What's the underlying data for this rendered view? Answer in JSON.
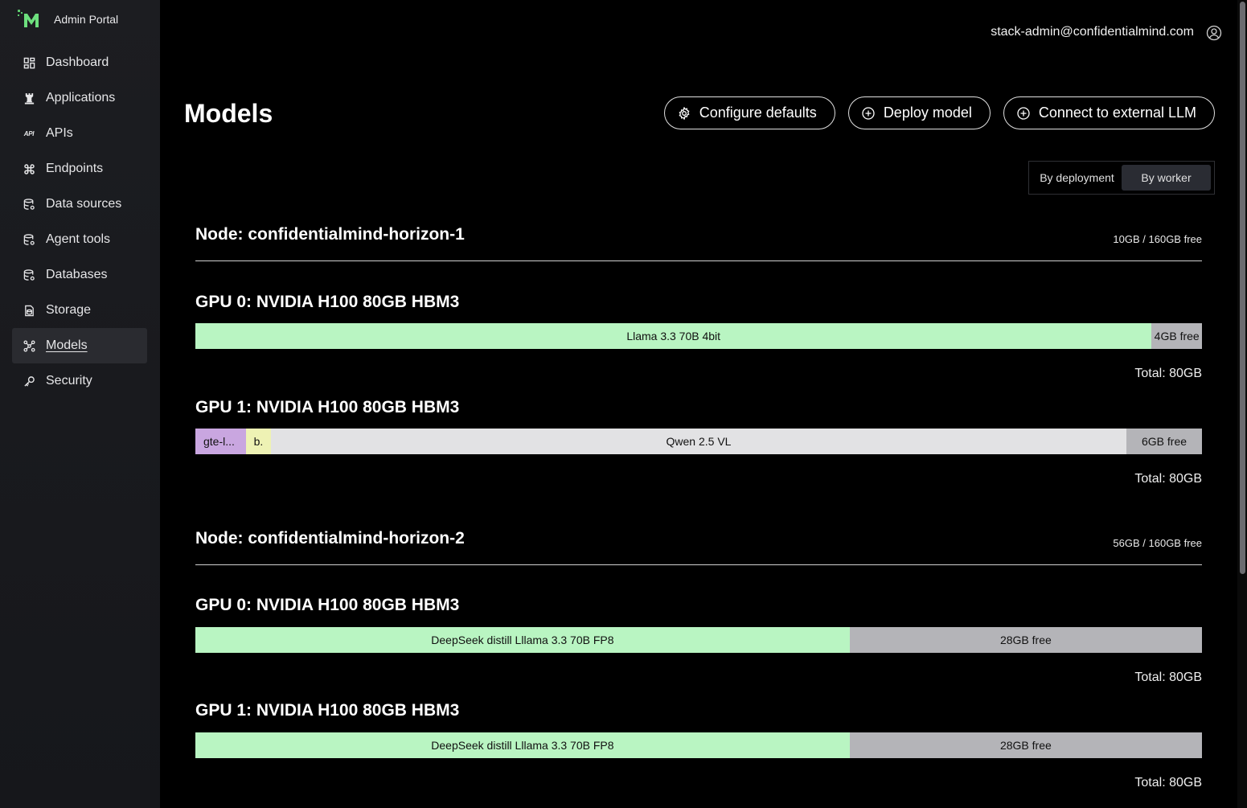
{
  "app": {
    "brand": "Admin Portal",
    "user_email": "stack-admin@confidentialmind.com"
  },
  "colors": {
    "model_green": "#b9f5c2",
    "free_gray": "#b4b4b8",
    "light_gray": "#e2e2e4",
    "purple": "#c9a6e0",
    "yellow": "#eef2b4"
  },
  "sidebar": {
    "items": [
      {
        "label": "Dashboard",
        "icon": "dashboard-icon"
      },
      {
        "label": "Applications",
        "icon": "chess-rook-icon"
      },
      {
        "label": "APIs",
        "icon": "api-icon",
        "icon_text": "API"
      },
      {
        "label": "Endpoints",
        "icon": "command-icon"
      },
      {
        "label": "Data sources",
        "icon": "database-cog-icon"
      },
      {
        "label": "Agent tools",
        "icon": "database-cog-icon"
      },
      {
        "label": "Databases",
        "icon": "database-cog-icon"
      },
      {
        "label": "Storage",
        "icon": "file-storage-icon"
      },
      {
        "label": "Models",
        "icon": "models-icon",
        "active": true
      },
      {
        "label": "Security",
        "icon": "key-icon"
      }
    ]
  },
  "page": {
    "title": "Models",
    "actions": {
      "configure": "Configure defaults",
      "deploy": "Deploy model",
      "connect": "Connect to external LLM"
    },
    "view_toggle": {
      "by_deployment": "By deployment",
      "by_worker": "By worker",
      "selected": "By worker"
    }
  },
  "nodes": [
    {
      "title": "Node: confidentialmind-horizon-1",
      "free": "10GB / 160GB free",
      "gpus": [
        {
          "title": "GPU 0: NVIDIA H100 80GB HBM3",
          "segments": [
            {
              "label": "Llama 3.3 70B 4bit",
              "gb": 76,
              "color": "#b9f5c2"
            },
            {
              "label": "4GB free",
              "gb": 4,
              "color": "#b4b4b8"
            }
          ],
          "total": "Total: 80GB"
        },
        {
          "title": "GPU 1: NVIDIA H100 80GB HBM3",
          "segments": [
            {
              "label": "gte-l...",
              "gb": 4,
              "color": "#c9a6e0"
            },
            {
              "label": "b.",
              "gb": 2,
              "color": "#eef2b4"
            },
            {
              "label": "Qwen 2.5 VL",
              "gb": 68,
              "color": "#e2e2e4"
            },
            {
              "label": "6GB free",
              "gb": 6,
              "color": "#b4b4b8"
            }
          ],
          "total": "Total: 80GB"
        }
      ]
    },
    {
      "title": "Node: confidentialmind-horizon-2",
      "free": "56GB / 160GB free",
      "gpus": [
        {
          "title": "GPU 0: NVIDIA H100 80GB HBM3",
          "segments": [
            {
              "label": "DeepSeek distill Lllama 3.3 70B FP8",
              "gb": 52,
              "color": "#b9f5c2"
            },
            {
              "label": "28GB free",
              "gb": 28,
              "color": "#b4b4b8"
            }
          ],
          "total": "Total: 80GB"
        },
        {
          "title": "GPU 1: NVIDIA H100 80GB HBM3",
          "segments": [
            {
              "label": "DeepSeek distill Lllama 3.3 70B FP8",
              "gb": 52,
              "color": "#b9f5c2"
            },
            {
              "label": "28GB free",
              "gb": 28,
              "color": "#b4b4b8"
            }
          ],
          "total": "Total: 80GB"
        }
      ]
    }
  ]
}
